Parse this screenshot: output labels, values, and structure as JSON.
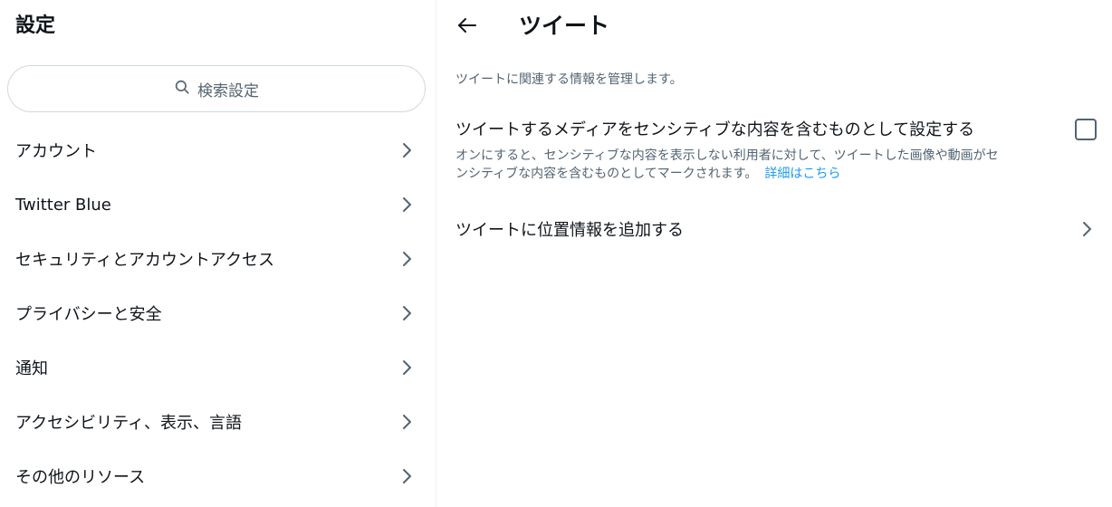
{
  "left": {
    "title": "設定",
    "search_placeholder": "検索設定",
    "menu": [
      {
        "label": "アカウント"
      },
      {
        "label": "Twitter Blue"
      },
      {
        "label": "セキュリティとアカウントアクセス"
      },
      {
        "label": "プライバシーと安全"
      },
      {
        "label": "通知"
      },
      {
        "label": "アクセシビリティ、表示、言語"
      },
      {
        "label": "その他のリソース"
      }
    ]
  },
  "right": {
    "title": "ツイート",
    "description": "ツイートに関連する情報を管理します。",
    "sensitive_media": {
      "label": "ツイートするメディアをセンシティブな内容を含むものとして設定する",
      "checked": false,
      "help_line1": "オンにすると、センシティブな内容を表示しない利用者に対して、ツイートした画像や動画がセ",
      "help_line2": "ンシティブな内容を含むものとしてマークされます。",
      "link": "詳細はこちら"
    },
    "location_row": {
      "label": "ツイートに位置情報を追加する"
    }
  },
  "colors": {
    "text_primary": "#0f1419",
    "text_secondary": "#536471",
    "link": "#1d9bf0",
    "border": "#cfd9de"
  },
  "icons": {
    "search": "search-icon",
    "chevron": "chevron-right-icon",
    "back": "back-arrow-icon"
  }
}
